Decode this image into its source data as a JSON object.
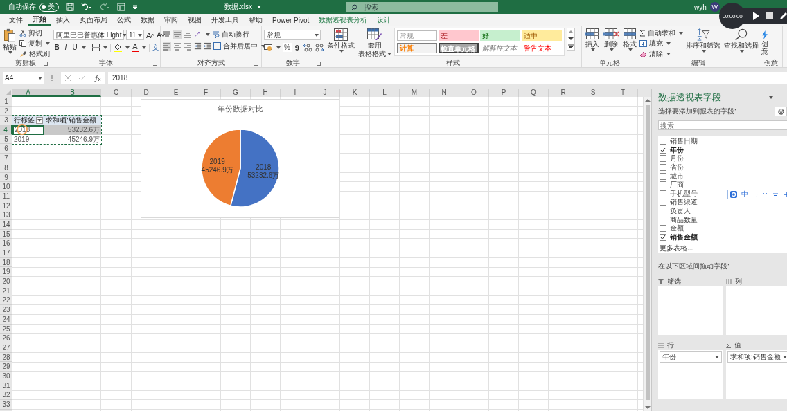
{
  "title_bar": {
    "autosave_label": "自动保存",
    "autosave_toggle": {
      "label": "关",
      "on": false
    },
    "file_name": "数据.xlsx",
    "search_placeholder": "搜索",
    "user": "wyh",
    "avatar": "W"
  },
  "recorder": {
    "time": "00:00:00"
  },
  "tabs": [
    {
      "label": "文件",
      "selected": false,
      "kind": "normal"
    },
    {
      "label": "开始",
      "selected": true,
      "kind": "normal"
    },
    {
      "label": "插入",
      "selected": false,
      "kind": "normal"
    },
    {
      "label": "页面布局",
      "selected": false,
      "kind": "normal"
    },
    {
      "label": "公式",
      "selected": false,
      "kind": "normal"
    },
    {
      "label": "数据",
      "selected": false,
      "kind": "normal"
    },
    {
      "label": "审阅",
      "selected": false,
      "kind": "normal"
    },
    {
      "label": "视图",
      "selected": false,
      "kind": "normal"
    },
    {
      "label": "开发工具",
      "selected": false,
      "kind": "normal"
    },
    {
      "label": "帮助",
      "selected": false,
      "kind": "normal"
    },
    {
      "label": "Power Pivot",
      "selected": false,
      "kind": "normal"
    },
    {
      "label": "数据透视表分析",
      "selected": false,
      "kind": "contextual"
    },
    {
      "label": "设计",
      "selected": false,
      "kind": "contextual"
    }
  ],
  "ribbon": {
    "clipboard": {
      "paste": "粘贴",
      "cut": "剪切",
      "copy": "复制",
      "format_painter": "格式刷",
      "label": "剪贴板"
    },
    "font": {
      "name": "阿里巴巴普惠体 Light",
      "size": "11",
      "grow": "A",
      "shrink": "A",
      "bold": "B",
      "italic": "I",
      "underline": "U",
      "font_color": "A",
      "phonetic": "文",
      "label": "字体"
    },
    "alignment": {
      "wrap": "自动换行",
      "merge": "合并后居中",
      "label": "对齐方式"
    },
    "number": {
      "format": "常规",
      "percent": "%",
      "comma": "9",
      "label": "数字"
    },
    "styles": {
      "conditional": "条件格式",
      "table_format": [
        "套用",
        "表格格式"
      ],
      "label": "样式"
    },
    "cell_styles": [
      {
        "label": "常规",
        "kind": "normal"
      },
      {
        "label": "差",
        "kind": "bad"
      },
      {
        "label": "好",
        "kind": "good"
      },
      {
        "label": "适中",
        "kind": "neutral"
      },
      {
        "label": "计算",
        "kind": "calculation"
      },
      {
        "label": "检查单元格",
        "kind": "check"
      },
      {
        "label": "解释性文本",
        "kind": "explanatory"
      },
      {
        "label": "警告文本",
        "kind": "warning"
      }
    ],
    "cells": {
      "insert": "插入",
      "delete": "删除",
      "format": "格式",
      "label": "单元格"
    },
    "editing": {
      "autosum": "自动求和",
      "fill": "填充",
      "clear": "清除",
      "sort": "排序和筛选",
      "find": "查找和选择",
      "label": "编辑"
    },
    "ideas": {
      "button": "创意",
      "label": "创意"
    }
  },
  "formula_bar": {
    "name_box": "A4",
    "value": "2018"
  },
  "sheet": {
    "columns": [
      {
        "label": "A",
        "selected": true
      },
      {
        "label": "B",
        "selected": true
      },
      {
        "label": "C",
        "selected": false
      },
      {
        "label": "D",
        "selected": false
      },
      {
        "label": "E",
        "selected": false
      },
      {
        "label": "F",
        "selected": false
      },
      {
        "label": "G",
        "selected": false
      },
      {
        "label": "H",
        "selected": false
      },
      {
        "label": "I",
        "selected": false
      },
      {
        "label": "J",
        "selected": false
      },
      {
        "label": "K",
        "selected": false
      },
      {
        "label": "L",
        "selected": false
      },
      {
        "label": "M",
        "selected": false
      },
      {
        "label": "N",
        "selected": false
      },
      {
        "label": "O",
        "selected": false
      },
      {
        "label": "P",
        "selected": false
      },
      {
        "label": "Q",
        "selected": false
      },
      {
        "label": "R",
        "selected": false
      },
      {
        "label": "S",
        "selected": false
      },
      {
        "label": "T",
        "selected": false
      }
    ],
    "rows": [
      {
        "label": "1",
        "selected": false
      },
      {
        "label": "2",
        "selected": false
      },
      {
        "label": "3",
        "selected": false
      },
      {
        "label": "4",
        "selected": true
      },
      {
        "label": "5",
        "selected": false
      },
      {
        "label": "6",
        "selected": false
      },
      {
        "label": "7",
        "selected": false
      },
      {
        "label": "8",
        "selected": false
      },
      {
        "label": "9",
        "selected": false
      },
      {
        "label": "10",
        "selected": false
      },
      {
        "label": "11",
        "selected": false
      },
      {
        "label": "12",
        "selected": false
      },
      {
        "label": "13",
        "selected": false
      },
      {
        "label": "14",
        "selected": false
      },
      {
        "label": "15",
        "selected": false
      },
      {
        "label": "16",
        "selected": false
      },
      {
        "label": "17",
        "selected": false
      },
      {
        "label": "18",
        "selected": false
      },
      {
        "label": "19",
        "selected": false
      },
      {
        "label": "20",
        "selected": false
      },
      {
        "label": "21",
        "selected": false
      },
      {
        "label": "22",
        "selected": false
      },
      {
        "label": "23",
        "selected": false
      },
      {
        "label": "24",
        "selected": false
      },
      {
        "label": "25",
        "selected": false
      },
      {
        "label": "26",
        "selected": false
      },
      {
        "label": "27",
        "selected": false
      },
      {
        "label": "28",
        "selected": false
      },
      {
        "label": "29",
        "selected": false
      },
      {
        "label": "30",
        "selected": false
      },
      {
        "label": "31",
        "selected": false
      },
      {
        "label": "32",
        "selected": false
      },
      {
        "label": "33",
        "selected": false
      }
    ],
    "pivot_table": {
      "header": [
        "行标签",
        "求和项:销售金额"
      ],
      "rows": [
        {
          "label": "2018",
          "value": "53232.6万",
          "selected": true
        },
        {
          "label": "2019",
          "value": "45246.9万",
          "selected": false
        }
      ]
    },
    "chart": {
      "chart_data": {
        "type": "pie",
        "title": "年份数据对比",
        "categories": [
          "2018",
          "2019"
        ],
        "values": [
          53232.6,
          45246.9
        ],
        "value_labels": [
          "53232.6万",
          "45246.9万"
        ],
        "data_labels": true
      }
    }
  },
  "pivot_panel": {
    "title": "数据透视表字段",
    "prompt": "选择要添加到报表的字段:",
    "search_placeholder": "搜索",
    "fields": [
      {
        "label": "销售日期",
        "checked": false
      },
      {
        "label": "年份",
        "checked": true
      },
      {
        "label": "月份",
        "checked": false
      },
      {
        "label": "省份",
        "checked": false
      },
      {
        "label": "城市",
        "checked": false
      },
      {
        "label": "厂商",
        "checked": false
      },
      {
        "label": "手机型号",
        "checked": false
      },
      {
        "label": "销售渠道",
        "checked": false
      },
      {
        "label": "负责人",
        "checked": false
      },
      {
        "label": "商品数量",
        "checked": false
      },
      {
        "label": "金额",
        "checked": false
      },
      {
        "label": "销售金额",
        "checked": true
      }
    ],
    "more_tables": "更多表格...",
    "areas_prompt": "在以下区域间拖动字段:",
    "areas": [
      {
        "kind": "filter",
        "label": "筛选"
      },
      {
        "kind": "columns",
        "label": "列"
      },
      {
        "kind": "rows",
        "label": "行",
        "items": [
          "年份"
        ]
      },
      {
        "kind": "values",
        "label": "值",
        "items": [
          "求和项:销售金额"
        ]
      }
    ]
  },
  "ime_toolbar": {
    "mode": "中"
  }
}
